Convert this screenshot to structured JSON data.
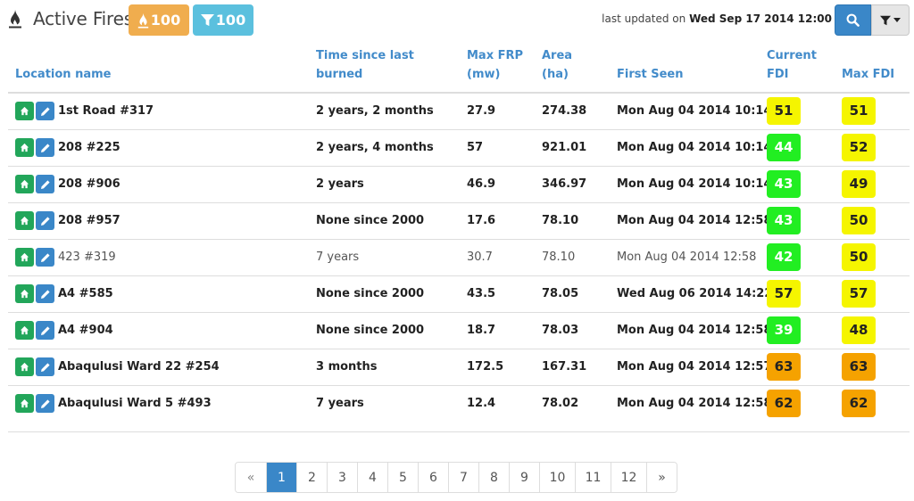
{
  "header": {
    "title": "Active Fires",
    "fire_count": "100",
    "filter_count": "100",
    "updated_prefix": "last updated on",
    "updated_value": "Wed Sep 17 2014 12:00"
  },
  "table": {
    "columns": [
      "Location name",
      "Time since last burned",
      "Max FRP (mw)",
      "Area (ha)",
      "First Seen",
      "Current FDI",
      "Max FDI"
    ],
    "rows": [
      {
        "location": "1st Road #317",
        "time": "2 years, 2 months",
        "frp": "27.9",
        "area": "274.38",
        "first_seen": "Mon Aug 04 2014 10:14",
        "current_fdi": "51",
        "current_level": "yellow",
        "max_fdi": "51",
        "max_level": "yellow",
        "style": "bold"
      },
      {
        "location": "208 #225",
        "time": "2 years, 4 months",
        "frp": "57",
        "area": "921.01",
        "first_seen": "Mon Aug 04 2014 10:14",
        "current_fdi": "44",
        "current_level": "green",
        "max_fdi": "52",
        "max_level": "yellow",
        "style": "bold"
      },
      {
        "location": "208 #906",
        "time": "2 years",
        "frp": "46.9",
        "area": "346.97",
        "first_seen": "Mon Aug 04 2014 10:14",
        "current_fdi": "43",
        "current_level": "green",
        "max_fdi": "49",
        "max_level": "yellow",
        "style": "bold"
      },
      {
        "location": "208 #957",
        "time": "None since 2000",
        "frp": "17.6",
        "area": "78.10",
        "first_seen": "Mon Aug 04 2014 12:58",
        "current_fdi": "43",
        "current_level": "green",
        "max_fdi": "50",
        "max_level": "yellow",
        "style": "bold"
      },
      {
        "location": "423 #319",
        "time": "7 years",
        "frp": "30.7",
        "area": "78.10",
        "first_seen": "Mon Aug 04 2014 12:58",
        "current_fdi": "42",
        "current_level": "green",
        "max_fdi": "50",
        "max_level": "yellow",
        "style": "normal"
      },
      {
        "location": "A4 #585",
        "time": "None since 2000",
        "frp": "43.5",
        "area": "78.05",
        "first_seen": "Wed Aug 06 2014 14:22",
        "current_fdi": "57",
        "current_level": "yellow",
        "max_fdi": "57",
        "max_level": "yellow",
        "style": "bold"
      },
      {
        "location": "A4 #904",
        "time": "None since 2000",
        "frp": "18.7",
        "area": "78.03",
        "first_seen": "Mon Aug 04 2014 12:58",
        "current_fdi": "39",
        "current_level": "green",
        "max_fdi": "48",
        "max_level": "yellow",
        "style": "bold"
      },
      {
        "location": "Abaqulusi Ward 22 #254",
        "time": "3 months",
        "frp": "172.5",
        "area": "167.31",
        "first_seen": "Mon Aug 04 2014 12:57",
        "current_fdi": "63",
        "current_level": "orange",
        "max_fdi": "63",
        "max_level": "orange",
        "style": "bold"
      },
      {
        "location": "Abaqulusi Ward 5 #493",
        "time": "7 years",
        "frp": "12.4",
        "area": "78.02",
        "first_seen": "Mon Aug 04 2014 12:58",
        "current_fdi": "62",
        "current_level": "orange",
        "max_fdi": "62",
        "max_level": "orange",
        "style": "bold"
      }
    ]
  },
  "pagination": {
    "prev": "«",
    "next": "»",
    "pages": [
      "1",
      "2",
      "3",
      "4",
      "5",
      "6",
      "7",
      "8",
      "9",
      "10",
      "11",
      "12"
    ],
    "active": "1"
  },
  "icons": {
    "brand": "fire-icon",
    "fire_badge": "fire-icon",
    "filter_badge": "filter-icon",
    "search": "search-icon",
    "filter_dropdown": "filter-icon",
    "row_home": "home-icon",
    "row_edit": "pencil-icon"
  },
  "colors": {
    "link_blue": "#428bca",
    "primary_button": "#3a87c8",
    "badge_fire": "#f0ad4e",
    "badge_filter": "#5bc0de",
    "action_home": "#22a65a",
    "fdi_green": "#22ee22",
    "fdi_yellow": "#f5f500",
    "fdi_orange": "#f5a200"
  }
}
